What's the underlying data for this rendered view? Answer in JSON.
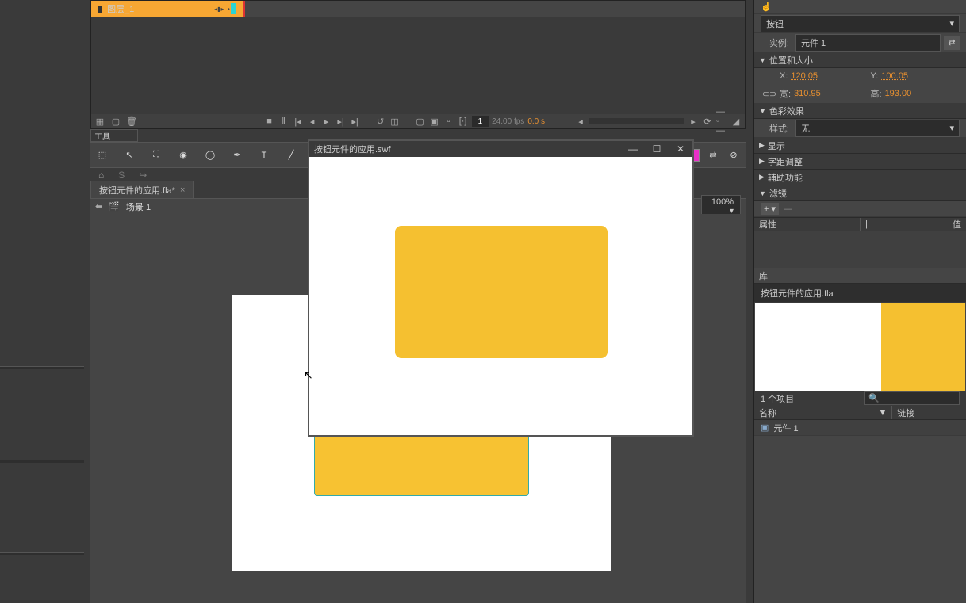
{
  "timeline": {
    "layer_name": "图层_1",
    "frame_number": "1",
    "fps": "24.00 fps",
    "time": "0.0 s"
  },
  "tools": {
    "header": "工具"
  },
  "tab": {
    "name": "按钮元件的应用.fla*"
  },
  "scene": {
    "name": "场景 1",
    "zoom": "100%"
  },
  "popup": {
    "title": "按钮元件的应用.swf"
  },
  "properties": {
    "type_label": "按钮",
    "instance_label": "实例:",
    "instance_value": "元件 1",
    "position_size_header": "位置和大小",
    "x_label": "X:",
    "x_value": "120.05",
    "y_label": "Y:",
    "y_value": "100.05",
    "width_label": "宽:",
    "width_value": "310.95",
    "height_label": "高:",
    "height_value": "193.00",
    "color_effect_header": "色彩效果",
    "style_label": "样式:",
    "style_value": "无",
    "display_header": "显示",
    "tracking_header": "字距调整",
    "accessibility_header": "辅助功能",
    "filters_header": "滤镜",
    "filter_prop": "属性",
    "filter_val": "值"
  },
  "library": {
    "tab": "库",
    "doc_name": "按钮元件的应用.fla",
    "item_count": "1 个项目",
    "name_header": "名称",
    "link_header": "链接",
    "item_name": "元件 1"
  }
}
